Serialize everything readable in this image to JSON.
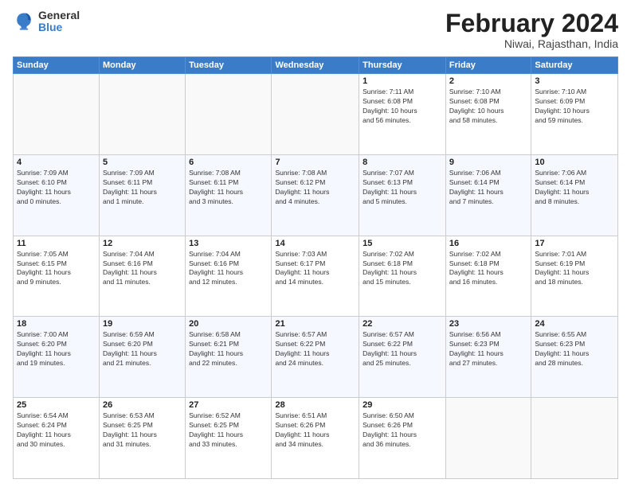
{
  "header": {
    "logo_general": "General",
    "logo_blue": "Blue",
    "month_title": "February 2024",
    "location": "Niwai, Rajasthan, India"
  },
  "days_of_week": [
    "Sunday",
    "Monday",
    "Tuesday",
    "Wednesday",
    "Thursday",
    "Friday",
    "Saturday"
  ],
  "weeks": [
    [
      {
        "day": "",
        "info": ""
      },
      {
        "day": "",
        "info": ""
      },
      {
        "day": "",
        "info": ""
      },
      {
        "day": "",
        "info": ""
      },
      {
        "day": "1",
        "info": "Sunrise: 7:11 AM\nSunset: 6:08 PM\nDaylight: 10 hours\nand 56 minutes."
      },
      {
        "day": "2",
        "info": "Sunrise: 7:10 AM\nSunset: 6:08 PM\nDaylight: 10 hours\nand 58 minutes."
      },
      {
        "day": "3",
        "info": "Sunrise: 7:10 AM\nSunset: 6:09 PM\nDaylight: 10 hours\nand 59 minutes."
      }
    ],
    [
      {
        "day": "4",
        "info": "Sunrise: 7:09 AM\nSunset: 6:10 PM\nDaylight: 11 hours\nand 0 minutes."
      },
      {
        "day": "5",
        "info": "Sunrise: 7:09 AM\nSunset: 6:11 PM\nDaylight: 11 hours\nand 1 minute."
      },
      {
        "day": "6",
        "info": "Sunrise: 7:08 AM\nSunset: 6:11 PM\nDaylight: 11 hours\nand 3 minutes."
      },
      {
        "day": "7",
        "info": "Sunrise: 7:08 AM\nSunset: 6:12 PM\nDaylight: 11 hours\nand 4 minutes."
      },
      {
        "day": "8",
        "info": "Sunrise: 7:07 AM\nSunset: 6:13 PM\nDaylight: 11 hours\nand 5 minutes."
      },
      {
        "day": "9",
        "info": "Sunrise: 7:06 AM\nSunset: 6:14 PM\nDaylight: 11 hours\nand 7 minutes."
      },
      {
        "day": "10",
        "info": "Sunrise: 7:06 AM\nSunset: 6:14 PM\nDaylight: 11 hours\nand 8 minutes."
      }
    ],
    [
      {
        "day": "11",
        "info": "Sunrise: 7:05 AM\nSunset: 6:15 PM\nDaylight: 11 hours\nand 9 minutes."
      },
      {
        "day": "12",
        "info": "Sunrise: 7:04 AM\nSunset: 6:16 PM\nDaylight: 11 hours\nand 11 minutes."
      },
      {
        "day": "13",
        "info": "Sunrise: 7:04 AM\nSunset: 6:16 PM\nDaylight: 11 hours\nand 12 minutes."
      },
      {
        "day": "14",
        "info": "Sunrise: 7:03 AM\nSunset: 6:17 PM\nDaylight: 11 hours\nand 14 minutes."
      },
      {
        "day": "15",
        "info": "Sunrise: 7:02 AM\nSunset: 6:18 PM\nDaylight: 11 hours\nand 15 minutes."
      },
      {
        "day": "16",
        "info": "Sunrise: 7:02 AM\nSunset: 6:18 PM\nDaylight: 11 hours\nand 16 minutes."
      },
      {
        "day": "17",
        "info": "Sunrise: 7:01 AM\nSunset: 6:19 PM\nDaylight: 11 hours\nand 18 minutes."
      }
    ],
    [
      {
        "day": "18",
        "info": "Sunrise: 7:00 AM\nSunset: 6:20 PM\nDaylight: 11 hours\nand 19 minutes."
      },
      {
        "day": "19",
        "info": "Sunrise: 6:59 AM\nSunset: 6:20 PM\nDaylight: 11 hours\nand 21 minutes."
      },
      {
        "day": "20",
        "info": "Sunrise: 6:58 AM\nSunset: 6:21 PM\nDaylight: 11 hours\nand 22 minutes."
      },
      {
        "day": "21",
        "info": "Sunrise: 6:57 AM\nSunset: 6:22 PM\nDaylight: 11 hours\nand 24 minutes."
      },
      {
        "day": "22",
        "info": "Sunrise: 6:57 AM\nSunset: 6:22 PM\nDaylight: 11 hours\nand 25 minutes."
      },
      {
        "day": "23",
        "info": "Sunrise: 6:56 AM\nSunset: 6:23 PM\nDaylight: 11 hours\nand 27 minutes."
      },
      {
        "day": "24",
        "info": "Sunrise: 6:55 AM\nSunset: 6:23 PM\nDaylight: 11 hours\nand 28 minutes."
      }
    ],
    [
      {
        "day": "25",
        "info": "Sunrise: 6:54 AM\nSunset: 6:24 PM\nDaylight: 11 hours\nand 30 minutes."
      },
      {
        "day": "26",
        "info": "Sunrise: 6:53 AM\nSunset: 6:25 PM\nDaylight: 11 hours\nand 31 minutes."
      },
      {
        "day": "27",
        "info": "Sunrise: 6:52 AM\nSunset: 6:25 PM\nDaylight: 11 hours\nand 33 minutes."
      },
      {
        "day": "28",
        "info": "Sunrise: 6:51 AM\nSunset: 6:26 PM\nDaylight: 11 hours\nand 34 minutes."
      },
      {
        "day": "29",
        "info": "Sunrise: 6:50 AM\nSunset: 6:26 PM\nDaylight: 11 hours\nand 36 minutes."
      },
      {
        "day": "",
        "info": ""
      },
      {
        "day": "",
        "info": ""
      }
    ]
  ]
}
